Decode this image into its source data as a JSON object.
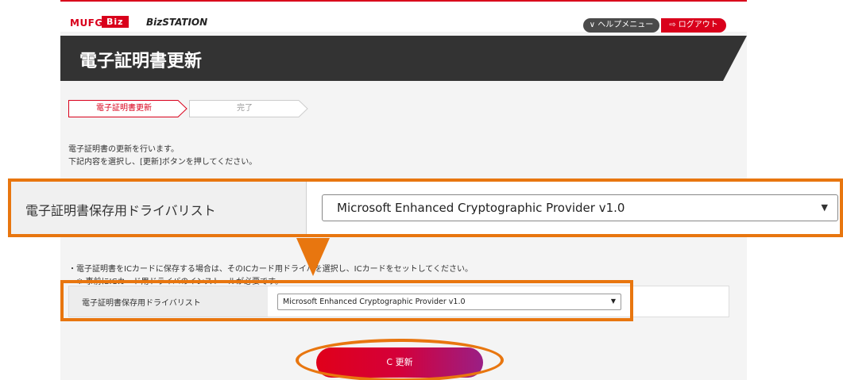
{
  "header": {
    "brand_mufg": "MUFG",
    "brand_biz": "Biz",
    "brand_station": "BizSTATION",
    "help_menu": "∨ ヘルプメニュー",
    "logout": "⇨ ログアウト"
  },
  "page": {
    "title": "電子証明書更新"
  },
  "steps": [
    {
      "label": "電子証明書更新",
      "active": true
    },
    {
      "label": "完了",
      "active": false
    }
  ],
  "description": {
    "line1": "電子証明書の更新を行います。",
    "line2": "下記内容を選択し、[更新]ボタンを押してください。"
  },
  "notes": {
    "line1": "・電子証明書をICカードに保存する場合は、そのICカード用ドライバを選択し、ICカードをセットしてください。",
    "line2": "※ 事前にICカード用ドライバのインストールが必要です。"
  },
  "driver_field": {
    "label": "電子証明書保存用ドライバリスト",
    "selected": "Microsoft Enhanced Cryptographic Provider v1.0"
  },
  "actions": {
    "update_label": "C 更新"
  },
  "colors": {
    "brand_red": "#d9001b",
    "highlight_orange": "#e8760f",
    "title_bar": "#333333"
  }
}
